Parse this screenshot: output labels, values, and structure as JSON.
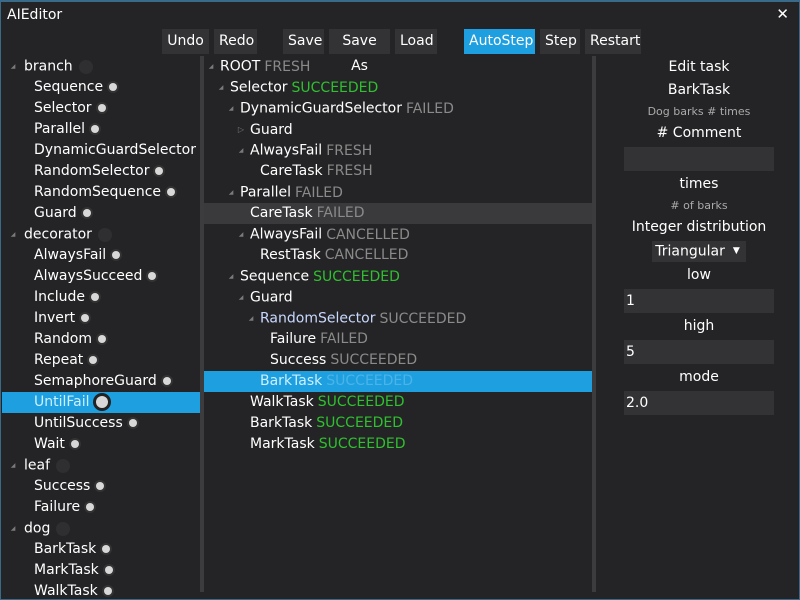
{
  "window": {
    "title": "AIEditor",
    "close_icon": "close-icon"
  },
  "toolbar": {
    "undo": "Undo",
    "redo": "Redo",
    "save": "Save",
    "save_as": "Save As",
    "load": "Load",
    "autostep": "AutoStep",
    "step": "Step",
    "restart": "Restart"
  },
  "palette": {
    "items": [
      {
        "label": "branch",
        "level": 0,
        "type": "category"
      },
      {
        "label": "Sequence",
        "level": 1
      },
      {
        "label": "Selector",
        "level": 1
      },
      {
        "label": "Parallel",
        "level": 1
      },
      {
        "label": "DynamicGuardSelector",
        "level": 1
      },
      {
        "label": "RandomSelector",
        "level": 1
      },
      {
        "label": "RandomSequence",
        "level": 1
      },
      {
        "label": "Guard",
        "level": 1
      },
      {
        "label": "decorator",
        "level": 0,
        "type": "category"
      },
      {
        "label": "AlwaysFail",
        "level": 1
      },
      {
        "label": "AlwaysSucceed",
        "level": 1
      },
      {
        "label": "Include",
        "level": 1
      },
      {
        "label": "Invert",
        "level": 1
      },
      {
        "label": "Random",
        "level": 1
      },
      {
        "label": "Repeat",
        "level": 1
      },
      {
        "label": "SemaphoreGuard",
        "level": 1
      },
      {
        "label": "UntilFail",
        "level": 1,
        "selected": true
      },
      {
        "label": "UntilSuccess",
        "level": 1
      },
      {
        "label": "Wait",
        "level": 1
      },
      {
        "label": "leaf",
        "level": 0,
        "type": "category"
      },
      {
        "label": "Success",
        "level": 1
      },
      {
        "label": "Failure",
        "level": 1
      },
      {
        "label": "dog",
        "level": 0,
        "type": "category"
      },
      {
        "label": "BarkTask",
        "level": 1
      },
      {
        "label": "MarkTask",
        "level": 1
      },
      {
        "label": "WalkTask",
        "level": 1
      }
    ]
  },
  "tree": {
    "nodes": [
      {
        "label": "ROOT",
        "status": "FRESH",
        "level": 0,
        "toggle": "open"
      },
      {
        "label": "Selector",
        "status": "SUCCEEDED",
        "level": 1,
        "toggle": "open"
      },
      {
        "label": "DynamicGuardSelector",
        "status": "FAILED",
        "level": 2,
        "toggle": "open"
      },
      {
        "label": "Guard",
        "status": "",
        "level": 3,
        "toggle": "closed"
      },
      {
        "label": "AlwaysFail",
        "status": "FRESH",
        "level": 3,
        "toggle": "open"
      },
      {
        "label": "CareTask",
        "status": "FRESH",
        "level": 4,
        "toggle": ""
      },
      {
        "label": "Parallel",
        "status": "FAILED",
        "level": 2,
        "toggle": "open"
      },
      {
        "label": "CareTask",
        "status": "FAILED",
        "level": 3,
        "toggle": "",
        "highlight": true
      },
      {
        "label": "AlwaysFail",
        "status": "CANCELLED",
        "level": 3,
        "toggle": "open"
      },
      {
        "label": "RestTask",
        "status": "CANCELLED",
        "level": 4,
        "toggle": ""
      },
      {
        "label": "Sequence",
        "status": "SUCCEEDED",
        "level": 2,
        "toggle": "open"
      },
      {
        "label": "Guard",
        "status": "",
        "level": 3,
        "toggle": "open"
      },
      {
        "label": "RandomSelector",
        "status": "SUCCEEDED",
        "level": 4,
        "toggle": "open",
        "dim_label": true
      },
      {
        "label": "Failure",
        "status": "FAILED",
        "level": 5,
        "toggle": ""
      },
      {
        "label": "Success",
        "status": "SUCCEEDED",
        "level": 5,
        "toggle": ""
      },
      {
        "label": "BarkTask",
        "status": "SUCCEEDED",
        "level": 4,
        "toggle": "",
        "selected": true
      },
      {
        "label": "WalkTask",
        "status": "SUCCEEDED",
        "level": 3,
        "toggle": "",
        "green": true
      },
      {
        "label": "BarkTask",
        "status": "SUCCEEDED",
        "level": 3,
        "toggle": "",
        "green": true
      },
      {
        "label": "MarkTask",
        "status": "SUCCEEDED",
        "level": 3,
        "toggle": "",
        "green": true
      }
    ]
  },
  "editor": {
    "heading": "Edit task",
    "task_name": "BarkTask",
    "task_desc": "Dog barks # times",
    "comment_label": "# Comment",
    "comment_value": "",
    "field_name": "times",
    "field_desc": "# of barks",
    "distribution_label": "Integer distribution",
    "distribution_value": "Triangular",
    "low_label": "low",
    "low_value": "1",
    "high_label": "high",
    "high_value": "5",
    "mode_label": "mode",
    "mode_value": "2.0"
  },
  "colors": {
    "accent": "#1e9fe0",
    "succeeded": "#2fc02f",
    "muted_status": "#8a8a8a",
    "background": "#242426",
    "control": "#333335"
  }
}
